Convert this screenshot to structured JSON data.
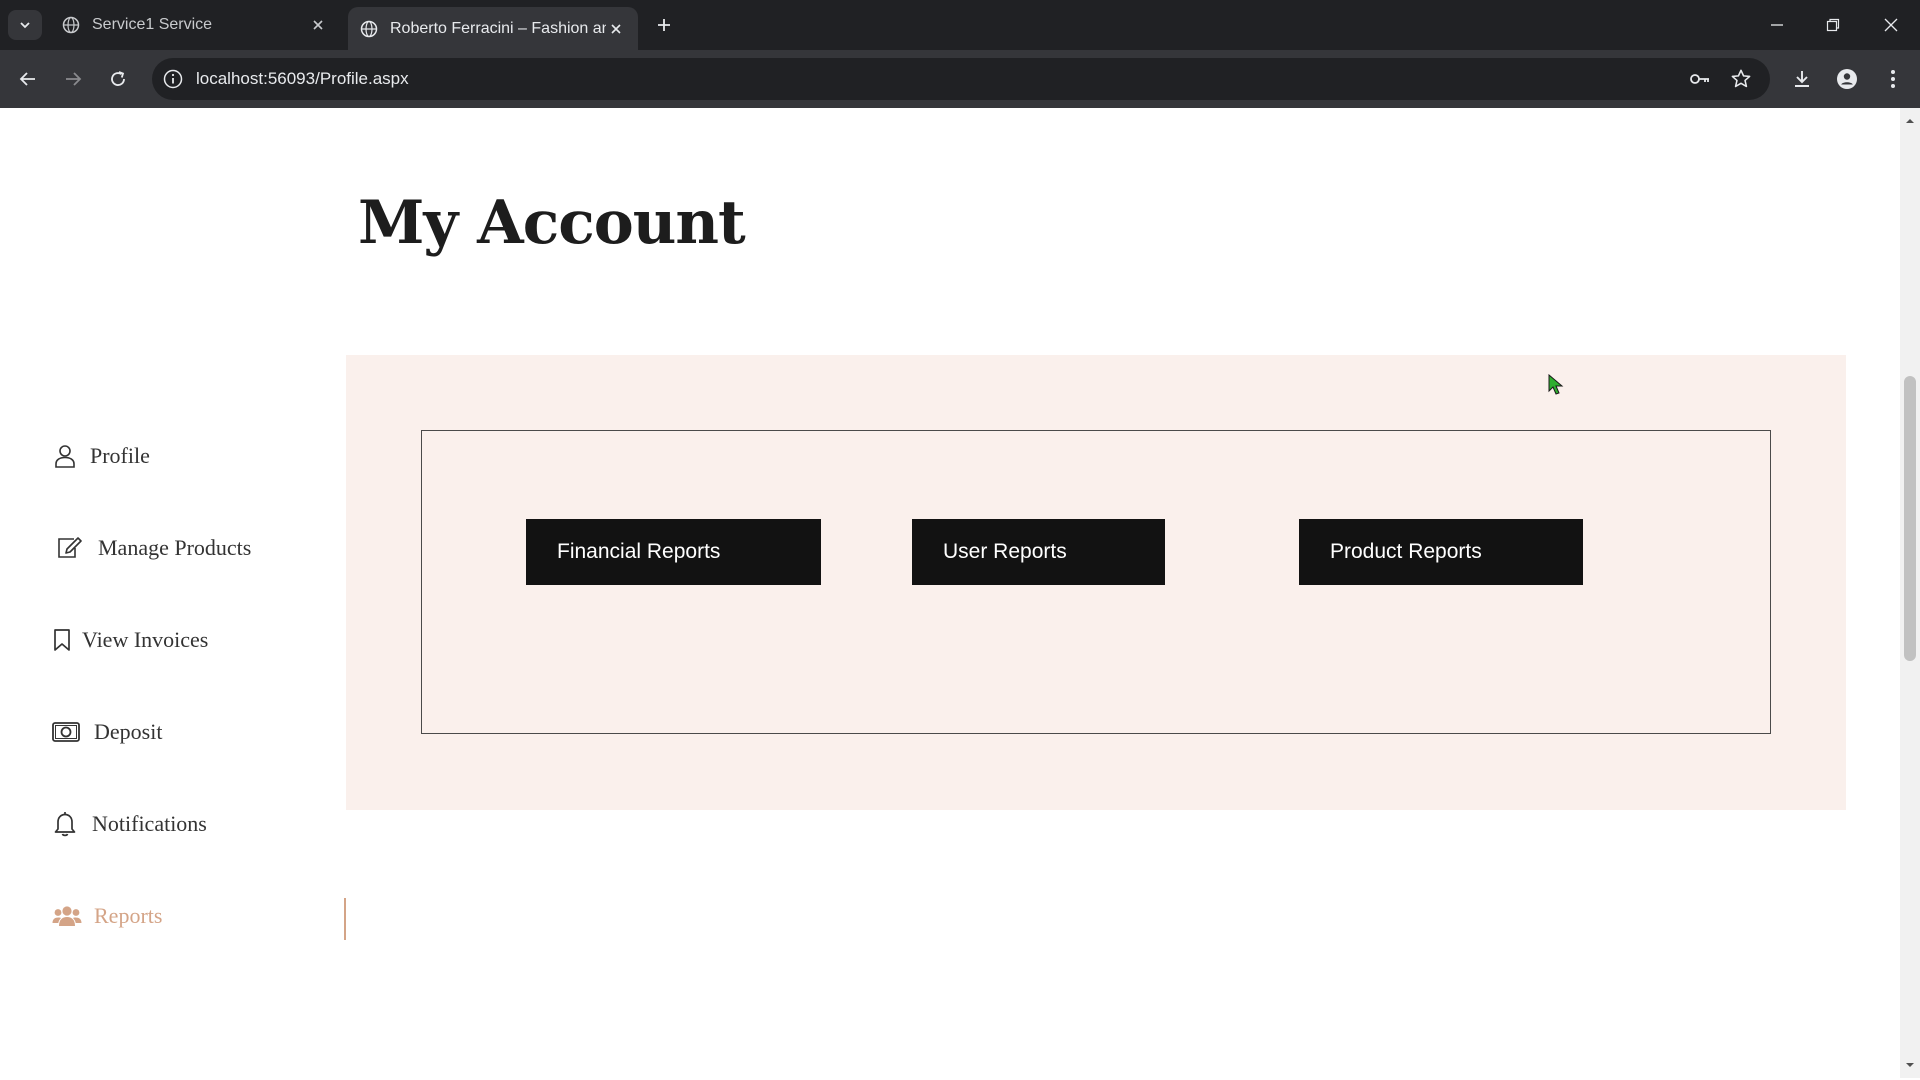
{
  "browser": {
    "tabs": [
      {
        "title": "Service1 Service",
        "active": false
      },
      {
        "title": "Roberto Ferracini – Fashion and",
        "active": true
      }
    ],
    "url": "localhost:56093/Profile.aspx"
  },
  "page": {
    "title": "My Account"
  },
  "sidebar": {
    "items": [
      {
        "label": "Profile",
        "icon": "user-icon"
      },
      {
        "label": "Manage Products",
        "icon": "edit-icon"
      },
      {
        "label": "View Invoices",
        "icon": "bookmark-icon"
      },
      {
        "label": "Deposit",
        "icon": "money-icon"
      },
      {
        "label": "Notifications",
        "icon": "bell-icon"
      },
      {
        "label": "Reports",
        "icon": "users-icon",
        "active": true
      }
    ]
  },
  "reports": {
    "buttons": [
      {
        "label": "Financial Reports"
      },
      {
        "label": "User Reports"
      },
      {
        "label": "Product Reports"
      }
    ]
  },
  "colors": {
    "accent": "#d4a487",
    "panel_bg": "#faf0ec",
    "button_bg": "#121212",
    "chrome_dark": "#202124",
    "chrome_toolbar": "#35363a"
  }
}
